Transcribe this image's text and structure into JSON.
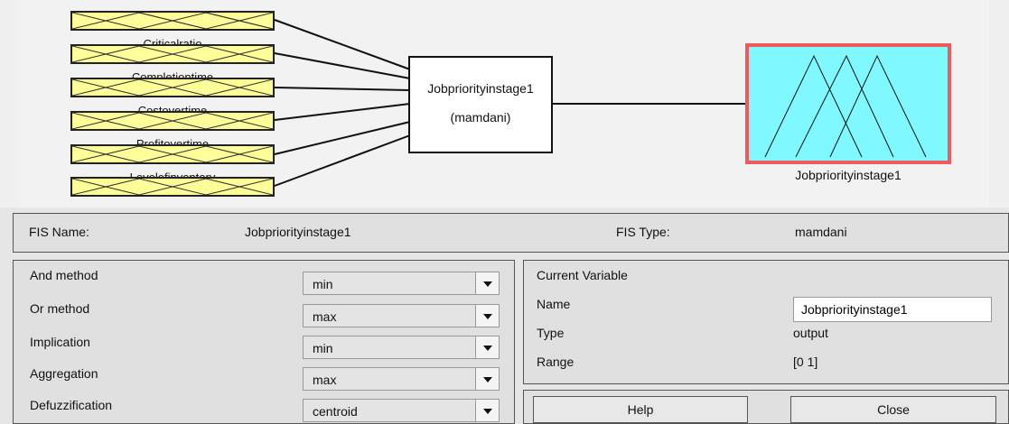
{
  "diagram": {
    "inputs": [
      {
        "label": "Criticalratio"
      },
      {
        "label": "Completiontime"
      },
      {
        "label": "Costovertime"
      },
      {
        "label": "Profitovertime"
      },
      {
        "label": "Levelofinventory"
      },
      {
        "label": ""
      }
    ],
    "system": {
      "name": "Jobpriorityinstage1",
      "type": "(mamdani)"
    },
    "output": {
      "label": "Jobpriorityinstage1",
      "color": "#7ff8ff",
      "border_color": "#ee5a5a"
    }
  },
  "info": {
    "fis_name_label": "FIS Name:",
    "fis_name_value": "Jobpriorityinstage1",
    "fis_type_label": "FIS Type:",
    "fis_type_value": "mamdani"
  },
  "methods": [
    {
      "label": "And method",
      "value": "min"
    },
    {
      "label": "Or method",
      "value": "max"
    },
    {
      "label": "Implication",
      "value": "min"
    },
    {
      "label": "Aggregation",
      "value": "max"
    },
    {
      "label": "Defuzzification",
      "value": "centroid"
    }
  ],
  "current_variable": {
    "title": "Current Variable",
    "name_label": "Name",
    "name_value": "Jobpriorityinstage1",
    "type_label": "Type",
    "type_value": "output",
    "range_label": "Range",
    "range_value": "[0 1]"
  },
  "buttons": {
    "help": "Help",
    "close": "Close"
  }
}
